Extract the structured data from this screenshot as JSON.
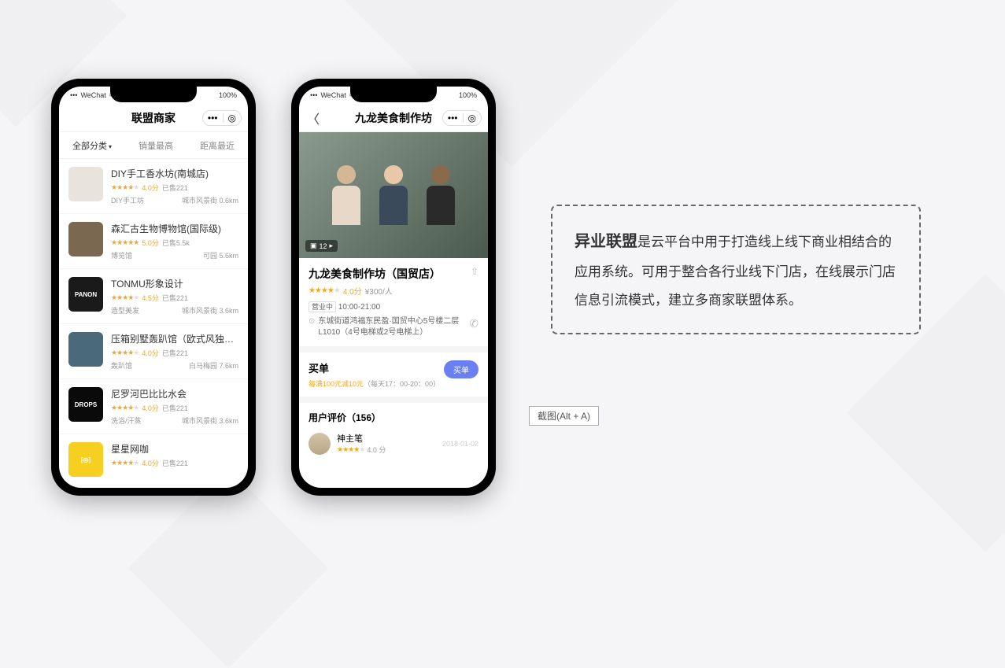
{
  "phone1": {
    "status": {
      "carrier": "WeChat",
      "battery": "100%"
    },
    "nav": {
      "title": "联盟商家",
      "more": "•••",
      "target": "◎"
    },
    "filters": [
      {
        "label": "全部分类",
        "dropdown": true
      },
      {
        "label": "销量最高",
        "dropdown": false
      },
      {
        "label": "距离最近",
        "dropdown": false
      }
    ],
    "items": [
      {
        "name": "DIY手工香水坊(南城店)",
        "score": "4.0分",
        "sold": "已售221",
        "tag": "DIY手工坊",
        "loc": "城市风景街",
        "dist": "0.6km",
        "stars": 4,
        "thumb": "#e8e4dc"
      },
      {
        "name": "森汇古生物博物馆(国际级)",
        "score": "5.0分",
        "sold": "已售5.5k",
        "tag": "博览馆",
        "loc": "可园",
        "dist": "5.6km",
        "stars": 5,
        "thumb": "#7a6850"
      },
      {
        "name": "TONMU形象设计",
        "score": "4.5分",
        "sold": "已售221",
        "tag": "造型美发",
        "loc": "城市风景街",
        "dist": "3.6km",
        "stars": 4,
        "thumb": "#1a1a1a",
        "thumbText": "PANON"
      },
      {
        "name": "压箱别墅轰趴馆（欧式风独栋私密别...",
        "score": "4.0分",
        "sold": "已售221",
        "tag": "轰趴馆",
        "loc": "白马梅园",
        "dist": "7.6km",
        "stars": 4,
        "thumb": "#4a6a7a"
      },
      {
        "name": "尼罗河巴比比水会",
        "score": "4.0分",
        "sold": "已售221",
        "tag": "洗浴/汗蒸",
        "loc": "城市风景街",
        "dist": "3.6km",
        "stars": 4,
        "thumb": "#0a0a0a",
        "thumbText": "DROPS"
      },
      {
        "name": "星星网咖",
        "score": "4.0分",
        "sold": "已售221",
        "tag": "",
        "loc": "",
        "dist": "",
        "stars": 4,
        "thumb": "#f5d020",
        "thumbText": "[◎]"
      }
    ]
  },
  "phone2": {
    "status": {
      "carrier": "WeChat",
      "battery": "100%"
    },
    "nav": {
      "back": "〈",
      "title": "九龙美食制作坊",
      "more": "•••",
      "target": "◎"
    },
    "hero": {
      "counter": "12",
      "counterIcon": "▣"
    },
    "shop": {
      "name": "九龙美食制作坊（国贸店）",
      "score": "4.0分",
      "price": "¥300/人",
      "hoursLabel": "营业中",
      "hours": "10:00-21:00",
      "address": "东城街道鸿福东民盈·国贸中心5号楼二层L1010（4号电梯或2号电梯上）"
    },
    "buy": {
      "title": "买单",
      "promoHighlight": "每满100元减10元",
      "promoTime": "（每天17：00-20：00）",
      "btn": "买单"
    },
    "reviews": {
      "title": "用户评价（156）",
      "item": {
        "name": "神主笔",
        "score": "4.0 分",
        "date": "2018-01-02"
      }
    }
  },
  "description": {
    "bold": "异业联盟",
    "text": "是云平台中用于打造线上线下商业相结合的应用系统。可用于整合各行业线下门店，在线展示门店信息引流模式，建立多商家联盟体系。"
  },
  "shortcut": "截图(Alt + A)"
}
